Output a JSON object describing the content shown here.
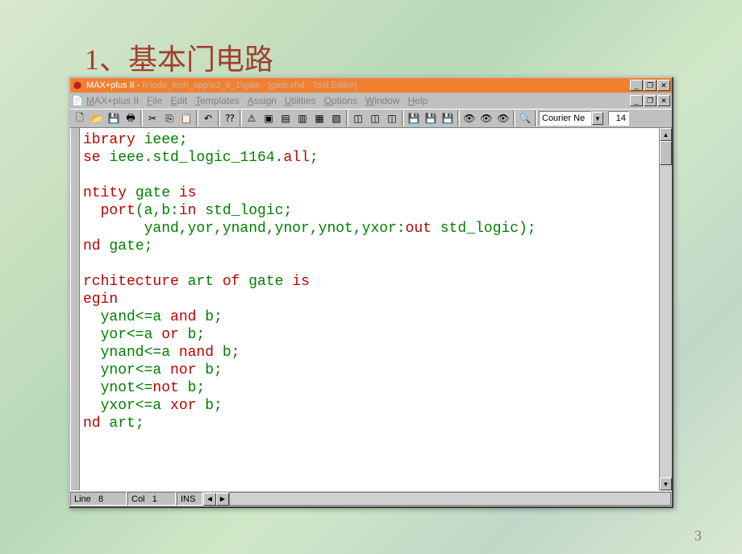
{
  "slide": {
    "title": "1、基本门电路",
    "page_number": "3"
  },
  "window": {
    "title_prefix": "MAX+plus II - ",
    "title_path": "h:\\eda_tech_app\\e3_9_1\\gate",
    "title_suffix": " - [gate.vhd - Text Editor]"
  },
  "menu": {
    "maxplus": "MAX+plus II",
    "file": "File",
    "edit": "Edit",
    "templates": "Templates",
    "assign": "Assign",
    "utilities": "Utilities",
    "options": "Options",
    "window": "Window",
    "help": "Help"
  },
  "toolbar": {
    "font_name": "Courier Ne",
    "font_size": "14"
  },
  "status": {
    "line_label": "Line",
    "line_val": "8",
    "col_label": "Col",
    "col_val": "1",
    "ins": "INS"
  },
  "code": {
    "l1a": "ibrary",
    "l1b": " ieee;",
    "l2a": "se",
    "l2b": " ieee.std_logic_1164.",
    "l2c": "all",
    "l2d": ";",
    "l4a": "ntity",
    "l4b": " gate ",
    "l4c": "is",
    "l5a": "  port",
    "l5b": "(a,b:",
    "l5c": "in",
    "l5d": " std_logic;",
    "l6a": "       yand,yor,ynand,ynor,ynot,yxor:",
    "l6b": "out",
    "l6c": " std_logic);",
    "l7a": "nd",
    "l7b": " gate;",
    "l9a": "rchitecture",
    "l9b": " art ",
    "l9c": "of",
    "l9d": " gate ",
    "l9e": "is",
    "l10a": "egin",
    "l11a": "  yand<=a ",
    "l11b": "and",
    "l11c": " b;",
    "l12a": "  yor<=a ",
    "l12b": "or",
    "l12c": " b;",
    "l13a": "  ynand<=a ",
    "l13b": "nand",
    "l13c": " b;",
    "l14a": "  ynor<=a ",
    "l14b": "nor",
    "l14c": " b;",
    "l15a": "  ynot<=",
    "l15b": "not",
    "l15c": " b;",
    "l16a": "  yxor<=a ",
    "l16b": "xor",
    "l16c": " b;",
    "l17a": "nd",
    "l17b": " art;"
  }
}
